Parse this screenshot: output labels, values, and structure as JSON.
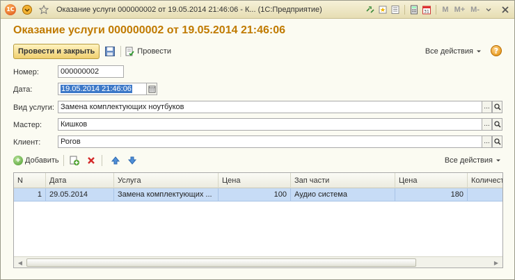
{
  "window": {
    "title": "Оказание услуги 000000002 от 19.05.2014 21:46:06 - К... (1С:Предприятие)",
    "right_toolbar": [
      "M",
      "M+",
      "M-"
    ]
  },
  "document": {
    "heading": "Оказание услуги 000000002 от 19.05.2014 21:46:06"
  },
  "toolbar": {
    "post_close_label": "Провести и закрыть",
    "post_label": "Провести",
    "all_actions_label": "Все действия",
    "help_label": "?"
  },
  "fields": {
    "number_label": "Номер:",
    "number_value": "000000002",
    "date_label": "Дата:",
    "date_value": "19.05.2014 21:46:06",
    "service_type_label": "Вид услуги:",
    "service_type_value": "Замена комплектующих ноутбуков",
    "master_label": "Мастер:",
    "master_value": "Кишков",
    "client_label": "Клиент:",
    "client_value": "Рогов",
    "choose_label": "...",
    "open_label": "🔍"
  },
  "table_toolbar": {
    "add_label": "Добавить",
    "all_actions_label": "Все действия"
  },
  "table": {
    "headers": [
      "N",
      "Дата",
      "Услуга",
      "Цена",
      "Зап части",
      "Цена",
      "Количест"
    ],
    "rows": [
      [
        "1",
        "29.05.2014",
        "Замена комплектующих ...",
        "100",
        "Аудио система",
        "180",
        ""
      ]
    ]
  },
  "colors": {
    "heading": "#c07a00",
    "selection": "#c7dcf6",
    "primary_button": "#f0d070"
  }
}
